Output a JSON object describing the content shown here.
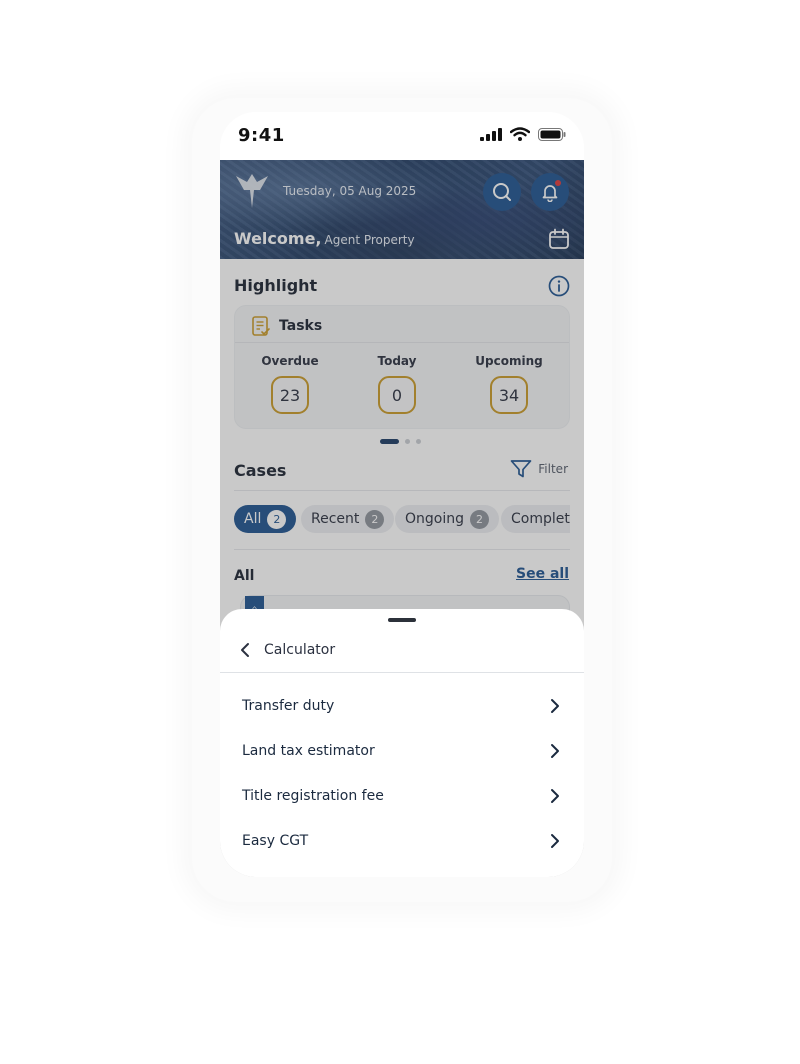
{
  "status_bar": {
    "time": "9:41"
  },
  "header": {
    "date": "Tuesday, 05 Aug 2025",
    "welcome": "Welcome,",
    "user_name": "Agent Property"
  },
  "highlight": {
    "title": "Highlight",
    "tasks": {
      "title": "Tasks",
      "columns": [
        {
          "label": "Overdue",
          "count": "23"
        },
        {
          "label": "Today",
          "count": "0"
        },
        {
          "label": "Upcoming",
          "count": "34"
        }
      ]
    },
    "carousel": {
      "active_page": 1,
      "total_pages": 3
    }
  },
  "cases": {
    "title": "Cases",
    "filter_label": "Filter",
    "chips": [
      {
        "label": "All",
        "count": "2",
        "active": true
      },
      {
        "label": "Recent",
        "count": "2",
        "active": false
      },
      {
        "label": "Ongoing",
        "count": "2",
        "active": false
      },
      {
        "label": "Completed",
        "count": "",
        "active": false
      }
    ],
    "list_title": "All",
    "see_all": "See all"
  },
  "sheet": {
    "title": "Calculator",
    "items": [
      {
        "label": "Transfer duty"
      },
      {
        "label": "Land tax estimator"
      },
      {
        "label": "Title registration fee"
      },
      {
        "label": "Easy CGT"
      }
    ]
  },
  "colors": {
    "primary": "#1f5491",
    "accent_gold": "#c99a27",
    "notification_dot": "#e03a3a",
    "text_dark": "#1d2433"
  },
  "icons": {
    "back": "chevron-left-icon",
    "forward": "chevron-right-icon",
    "search": "search-icon",
    "notification": "bell-icon",
    "calendar": "calendar-icon",
    "info": "info-icon",
    "filter": "filter-icon",
    "tasks": "clipboard-check-icon"
  }
}
